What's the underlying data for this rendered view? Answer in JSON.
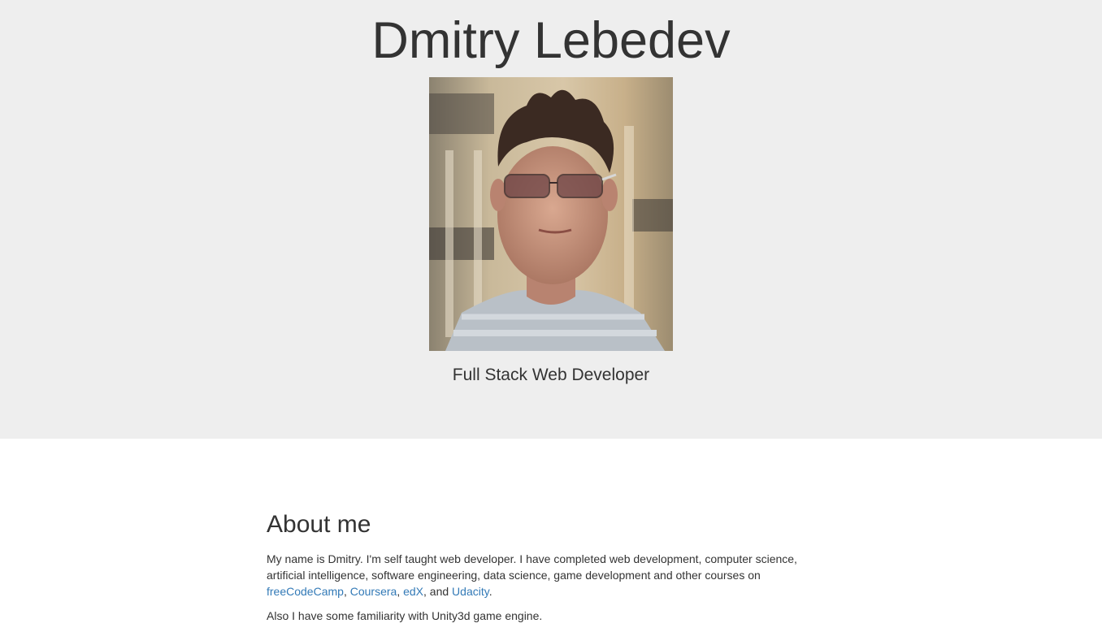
{
  "header": {
    "name": "Dmitry Lebedev",
    "role": "Full Stack Web Developer",
    "portrait_icon": "portrait-photo"
  },
  "about": {
    "heading": "About me",
    "intro_text": "My name is Dmitry. I'm self taught web developer. I have completed web development, computer science, artificial intelligence, software engineering, data science, game development and other courses on ",
    "links": [
      {
        "label": "freeCodeCamp"
      },
      {
        "label": "Coursera"
      },
      {
        "label": "edX"
      },
      {
        "label": "Udacity"
      }
    ],
    "sep_comma": ", ",
    "sep_and": ", and ",
    "end_period": ".",
    "unity_text": "Also I have some familiarity with Unity3d game engine."
  },
  "colors": {
    "hero_bg": "#eeeeee",
    "text": "#333333",
    "link": "#337ab7"
  }
}
